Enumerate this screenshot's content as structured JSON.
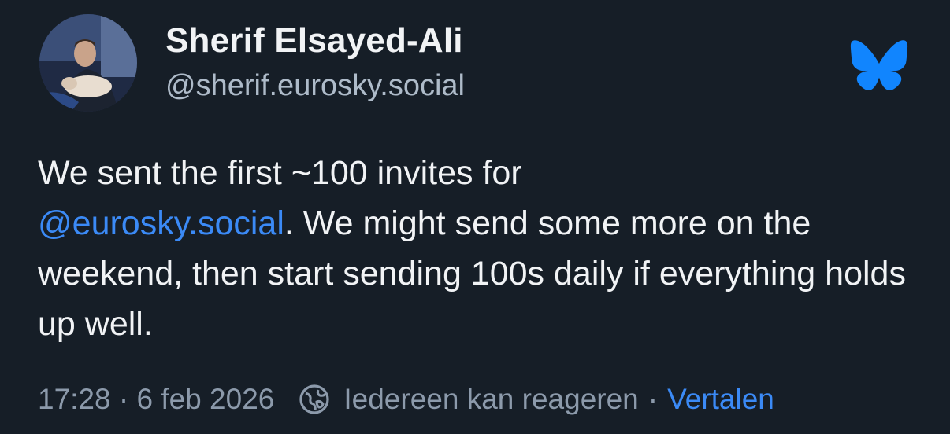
{
  "post": {
    "author": {
      "display_name": "Sherif Elsayed-Ali",
      "handle": "@sherif.eurosky.social",
      "avatar_icon": "profile-photo"
    },
    "text": {
      "line1": "We sent the first ~100 invites for",
      "mention": "@eurosky.social",
      "after_mention": ". We might send some more on the weekend, then start sending 100s daily if everything holds up well."
    },
    "meta": {
      "timestamp": "17:28 · 6 feb 2026",
      "reply_setting": "Iedereen kan reageren",
      "separator": "·",
      "translate_label": "Vertalen"
    },
    "logo_icon": "bluesky-butterfly-icon"
  },
  "colors": {
    "background": "#161e27",
    "text": "#f1f3f5",
    "muted": "#8c9aab",
    "link": "#3b8af6",
    "brand": "#1185fe"
  }
}
